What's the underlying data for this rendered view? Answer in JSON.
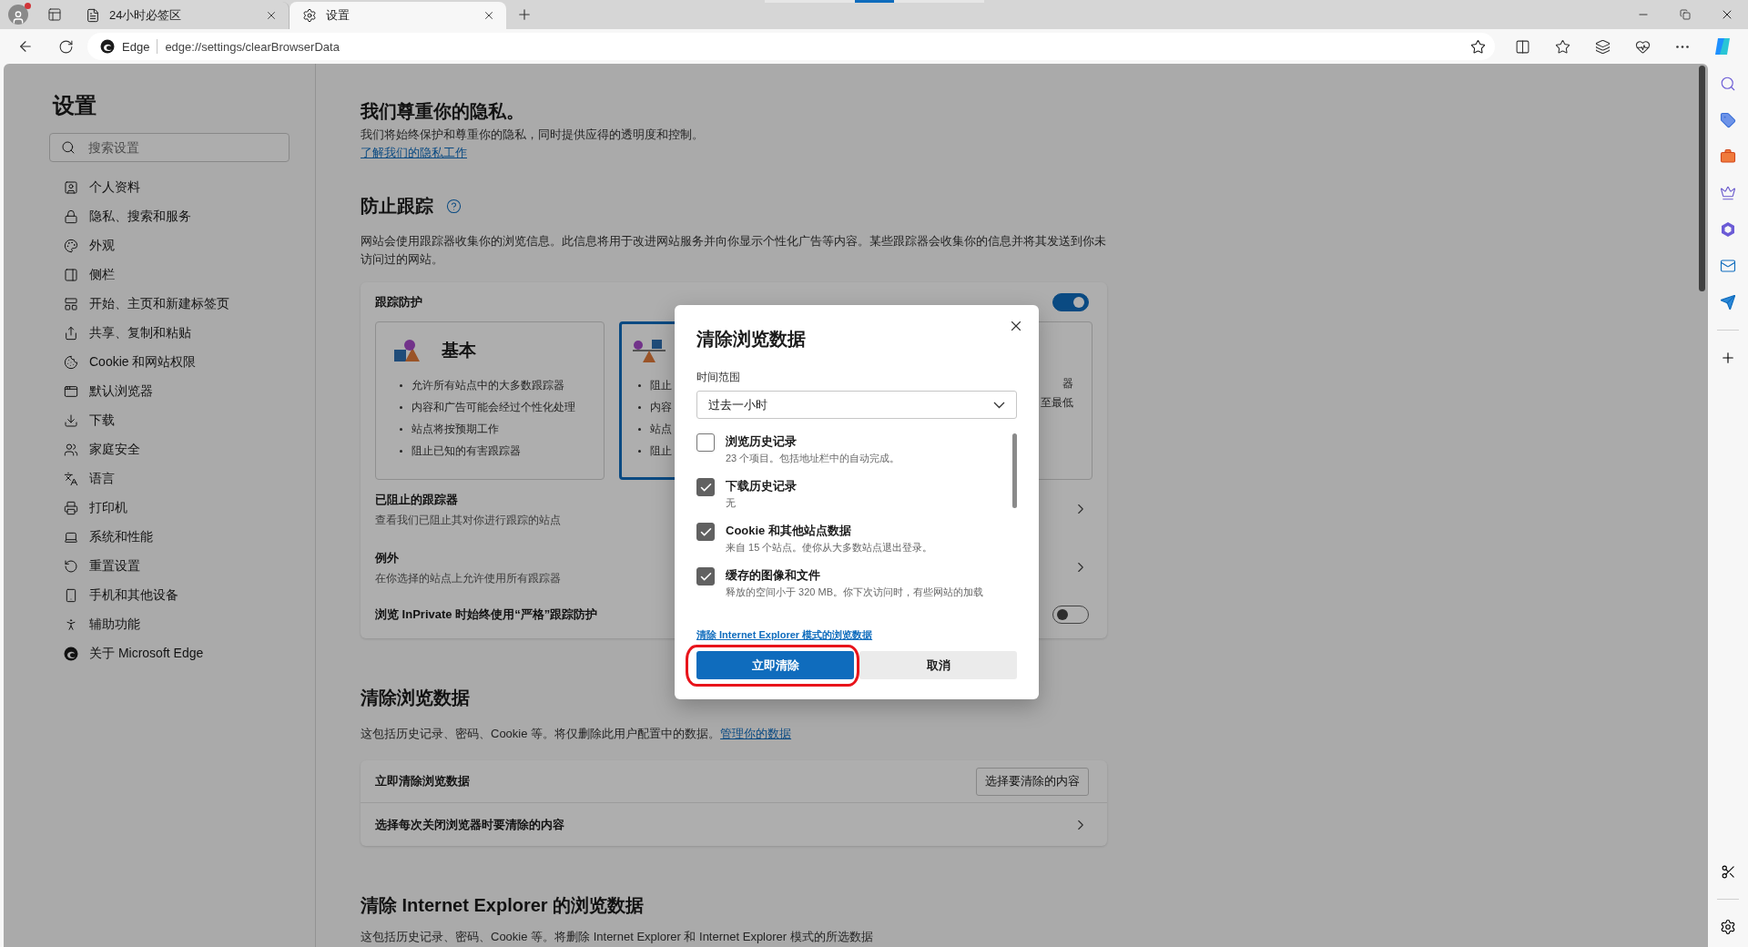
{
  "browser": {
    "tabs": [
      {
        "title": "24小时必签区",
        "selected": false
      },
      {
        "title": "设置",
        "selected": true
      }
    ],
    "address": {
      "site_label": "Edge",
      "url": "edge://settings/clearBrowserData"
    }
  },
  "settings_nav": {
    "title": "设置",
    "search": {
      "placeholder": "搜索设置"
    },
    "items": [
      {
        "label": "个人资料"
      },
      {
        "label": "隐私、搜索和服务"
      },
      {
        "label": "外观"
      },
      {
        "label": "侧栏"
      },
      {
        "label": "开始、主页和新建标签页"
      },
      {
        "label": "共享、复制和粘贴"
      },
      {
        "label": "Cookie 和网站权限"
      },
      {
        "label": "默认浏览器"
      },
      {
        "label": "下载"
      },
      {
        "label": "家庭安全"
      },
      {
        "label": "语言"
      },
      {
        "label": "打印机"
      },
      {
        "label": "系统和性能"
      },
      {
        "label": "重置设置"
      },
      {
        "label": "手机和其他设备"
      },
      {
        "label": "辅助功能"
      },
      {
        "label": "关于 Microsoft Edge"
      }
    ]
  },
  "privacy": {
    "heading": "我们尊重你的隐私。",
    "text": "我们将始终保护和尊重你的隐私，同时提供应得的透明度和控制。",
    "link": "了解我们的隐私工作"
  },
  "tracking": {
    "heading": "防止跟踪",
    "description": "网站会使用跟踪器收集你的浏览信息。此信息将用于改进网站服务并向你显示个性化广告等内容。某些跟踪器会收集你的信息并将其发送到你未访问过的网站。",
    "panel": {
      "title": "跟踪防护",
      "on": true,
      "levels": [
        {
          "title": "基本",
          "selected": false,
          "bullets": [
            "允许所有站点中的大多数跟踪器",
            "内容和广告可能会经过个性化处理",
            "站点将按预期工作",
            "阻止已知的有害跟踪器"
          ]
        },
        {
          "selected": true,
          "bullets": [
            "阻止",
            "内容",
            "站点",
            "阻止"
          ]
        },
        {
          "selected": false,
          "bullets": [
            "器",
            "至最低"
          ]
        }
      ],
      "rows": [
        {
          "kind": "link",
          "title": "已阻止的跟踪器",
          "subtitle": "查看我们已阻止其对你进行跟踪的站点"
        },
        {
          "kind": "link",
          "title": "例外",
          "subtitle": "在你选择的站点上允许使用所有跟踪器"
        },
        {
          "kind": "toggle",
          "title": "浏览 InPrivate 时始终使用“严格”跟踪防护",
          "on": false
        }
      ]
    }
  },
  "clear_data": {
    "heading": "清除浏览数据",
    "description": "这包括历史记录、密码、Cookie 等。将仅删除此用户配置中的数据。",
    "link": "管理你的数据",
    "rows": [
      {
        "kind": "button",
        "title": "立即清除浏览数据",
        "button": "选择要清除的内容"
      },
      {
        "kind": "link",
        "title": "选择每次关闭浏览器时要清除的内容"
      }
    ]
  },
  "clear_ie": {
    "heading": "清除 Internet Explorer 的浏览数据",
    "description": "这包括历史记录、密码、Cookie 等。将删除 Internet Explorer 和 Internet Explorer 模式的所选数据"
  },
  "dialog": {
    "title": "清除浏览数据",
    "range_label": "时间范围",
    "range_value": "过去一小时",
    "options": [
      {
        "label": "浏览历史记录",
        "detail": "23 个项目。包括地址栏中的自动完成。",
        "checked": false
      },
      {
        "label": "下载历史记录",
        "detail": "无",
        "checked": true
      },
      {
        "label": "Cookie 和其他站点数据",
        "detail": "来自 15 个站点。使你从大多数站点退出登录。",
        "checked": true
      },
      {
        "label": "缓存的图像和文件",
        "detail": "释放的空间小于 320 MB。你下次访问时，有些网站的加载",
        "checked": true
      }
    ],
    "ie_link": "清除 Internet Explorer 模式的浏览数据",
    "buttons": [
      {
        "kind": "primary",
        "label": "立即清除",
        "highlighted": true
      },
      {
        "kind": "secondary",
        "label": "取消",
        "highlighted": false
      }
    ]
  }
}
